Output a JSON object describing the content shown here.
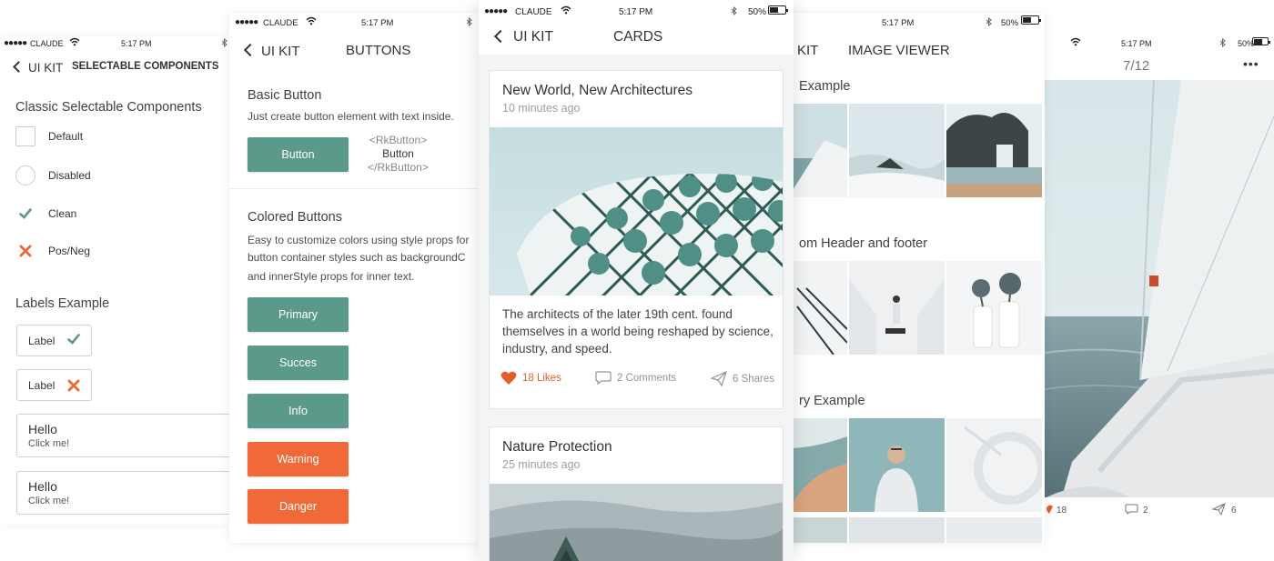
{
  "colors": {
    "teal": "#5b9a8b",
    "orange": "#ef6a38",
    "like_red": "#e35d2f",
    "text_dark": "#3d4146"
  },
  "statusbar": {
    "carrier": "CLAUDE",
    "time": "5:17 PM",
    "battery": "50%"
  },
  "screen1": {
    "back": "UI KIT",
    "title": "SELECTABLE COMPONENTS",
    "section1": "Classic Selectable Components",
    "items": [
      {
        "label": "Default",
        "icon": "square-checkbox"
      },
      {
        "label": "Disabled",
        "icon": "circle-radio"
      },
      {
        "label": "Clean",
        "icon": "check-icon"
      },
      {
        "label": "Pos/Neg",
        "icon": "cross-icon"
      }
    ],
    "section2": "Labels Example",
    "chips": [
      {
        "label": "Label",
        "icon": "check-icon"
      },
      {
        "label": "Label",
        "icon": "cross-icon"
      }
    ],
    "cards": [
      {
        "title": "Hello",
        "subtitle": "Click me!"
      },
      {
        "title": "Hello",
        "subtitle": "Click me!"
      }
    ]
  },
  "screen2": {
    "back": "UI KIT",
    "title": "BUTTONS",
    "basic_heading": "Basic Button",
    "basic_desc": "Just create button element with text inside.",
    "basic_button": "Button",
    "code_open": "<RkButton>",
    "code_text": "Button",
    "code_close": "</RkButton>",
    "colored_heading": "Colored Buttons",
    "colored_desc": [
      "Easy to customize colors using style props for",
      "button container styles  such as backgroundC",
      "and innerStyle props for inner text."
    ],
    "buttons": [
      "Primary",
      "Succes",
      "Info",
      "Warning",
      "Danger"
    ]
  },
  "screen3": {
    "back": "UI KIT",
    "title": "CARDS",
    "cards": [
      {
        "title": "New World, New Architectures",
        "time": "10 minutes ago",
        "body": "The architects of the later 19th cent. found themselves in a world being reshaped by science, industry, and speed.",
        "likes": "18 Likes",
        "comments": "2 Comments",
        "shares": "6 Shares"
      },
      {
        "title": "Nature Protection",
        "time": "25 minutes ago"
      }
    ]
  },
  "screen4": {
    "back": "KIT",
    "title": "IMAGE VIEWER",
    "sections": [
      "Example",
      "om Header and footer",
      "ry Example"
    ]
  },
  "screen5": {
    "counter": "7/12",
    "more": "•••",
    "likes": "18",
    "comments": "2",
    "shares": "6"
  }
}
